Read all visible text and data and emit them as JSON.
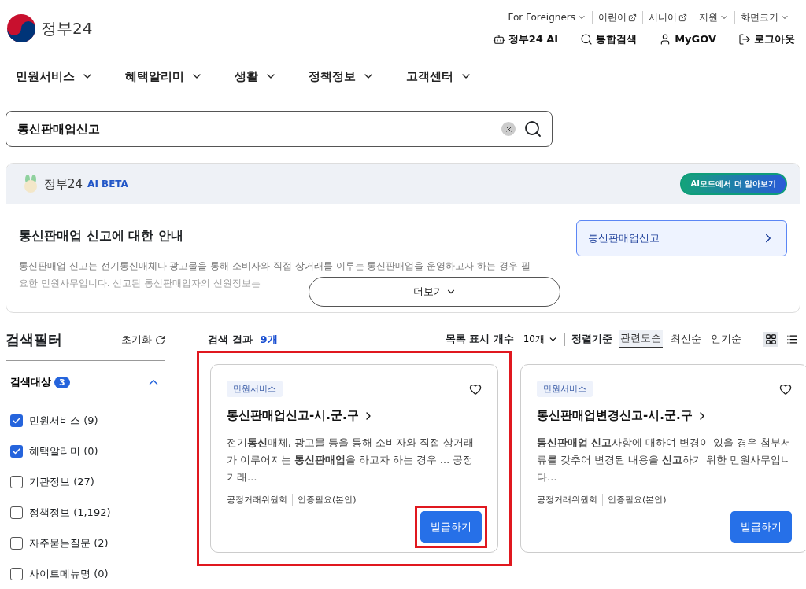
{
  "header": {
    "logo_text": "정부24",
    "utility_links": [
      {
        "label": "For Foreigners",
        "kind": "dropdown"
      },
      {
        "label": "어린이",
        "kind": "external"
      },
      {
        "label": "시니어",
        "kind": "external"
      },
      {
        "label": "지원",
        "kind": "dropdown"
      },
      {
        "label": "화면크기",
        "kind": "dropdown"
      }
    ],
    "main_links": [
      {
        "label": "정부24 AI",
        "kind": "ai"
      },
      {
        "label": "통합검색",
        "kind": "search"
      },
      {
        "label": "MyGOV",
        "kind": "user"
      },
      {
        "label": "로그아웃",
        "kind": "logout"
      }
    ]
  },
  "nav": [
    "민원서비스",
    "혜택알리미",
    "생활",
    "정책정보",
    "고객센터"
  ],
  "search": {
    "value": "통신판매업신고"
  },
  "ai_panel": {
    "brand": "정부24",
    "badge": "AI BETA",
    "mode_button": "AI모드에서 더 알아보기",
    "title": "통신판매업 신고에 대한 안내",
    "body_lines": [
      "통신판매업 신고는 전기통신매체나 광고물을 통해 소비자와 직접 상거래를 이루는 통신판매업을 운영하고자 하는 경우 필",
      "요한 민원사무입니다. 신고된 통신판매업자의 신원정보는"
    ],
    "link": "통신판매업신고",
    "more": "더보기"
  },
  "filter": {
    "title": "검색필터",
    "reset": "초기화",
    "group": {
      "label": "검색대상",
      "count": "3",
      "expanded": true
    },
    "options": [
      {
        "label": "민원서비스 (9)",
        "checked": true
      },
      {
        "label": "혜택알리미 (0)",
        "checked": true
      },
      {
        "label": "기관정보 (27)",
        "checked": false
      },
      {
        "label": "정책정보 (1,192)",
        "checked": false
      },
      {
        "label": "자주묻는질문 (2)",
        "checked": false
      },
      {
        "label": "사이트메뉴명 (0)",
        "checked": false
      }
    ]
  },
  "results": {
    "label": "검색 결과",
    "count": "9개",
    "page_size_label": "목록 표시 개수",
    "page_size": "10개",
    "sort_label": "정렬기준",
    "sorts": [
      {
        "label": "관련도순",
        "selected": true
      },
      {
        "label": "최신순",
        "selected": false
      },
      {
        "label": "인기순",
        "selected": false
      }
    ],
    "view_buttons": [
      {
        "kind": "grid",
        "selected": true
      },
      {
        "kind": "list",
        "selected": false
      }
    ],
    "cards": [
      {
        "tag": "민원서비스",
        "title": "**통신판매업신고**-시.군.구",
        "desc": "전기**통신**매체, 광고물 등을 통해 소비자와 직접 상거래가 이루어지는 **통신판매업**을 하고자 하는 경우 … 공정거래…",
        "agency": "공정거래위원회",
        "auth": "인증필요(본인)",
        "button": "발급하기",
        "highlighted": true,
        "favorite": false
      },
      {
        "tag": "민원서비스",
        "title": "**통신판매업**변경**신고**-시.군.구",
        "desc": "**통신판매업 신고**사항에 대하여 변경이 있을 경우 첨부서류를 갖추어 변경된 내용을 **신고**하기 위한 민원사무입니다…",
        "agency": "공정거래위원회",
        "auth": "인증필요(본인)",
        "button": "발급하기",
        "highlighted": false,
        "favorite": false
      }
    ]
  }
}
